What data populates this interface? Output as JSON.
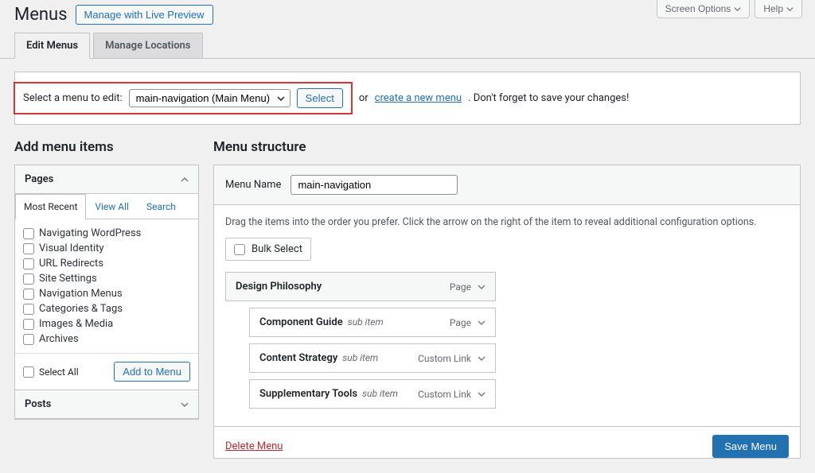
{
  "top": {
    "screen_options": "Screen Options",
    "help": "Help"
  },
  "header": {
    "title": "Menus",
    "live_preview": "Manage with Live Preview"
  },
  "tabs": {
    "edit": "Edit Menus",
    "locations": "Manage Locations"
  },
  "selectbar": {
    "label": "Select a menu to edit:",
    "selected": "main-navigation (Main Menu)",
    "select_btn": "Select",
    "or": "or",
    "create_link": "create a new menu",
    "tail": ". Don't forget to save your changes!"
  },
  "left": {
    "heading": "Add menu items",
    "pages_title": "Pages",
    "subtabs": {
      "recent": "Most Recent",
      "view_all": "View All",
      "search": "Search"
    },
    "pages": [
      "Navigating WordPress",
      "Visual Identity",
      "URL Redirects",
      "Site Settings",
      "Navigation Menus",
      "Categories & Tags",
      "Images & Media",
      "Archives"
    ],
    "select_all": "Select All",
    "add_btn": "Add to Menu",
    "posts_title": "Posts"
  },
  "right": {
    "heading": "Menu structure",
    "name_label": "Menu Name",
    "name_value": "main-navigation",
    "hint": "Drag the items into the order you prefer. Click the arrow on the right of the item to reveal additional configuration options.",
    "bulk": "Bulk Select",
    "items": [
      {
        "title": "Design Philosophy",
        "sub": false,
        "type": "Page"
      },
      {
        "title": "Component Guide",
        "sub": true,
        "type": "Page"
      },
      {
        "title": "Content Strategy",
        "sub": true,
        "type": "Custom Link"
      },
      {
        "title": "Supplementary Tools",
        "sub": true,
        "type": "Custom Link"
      }
    ],
    "sub_label": "sub item",
    "delete": "Delete Menu",
    "save": "Save Menu"
  }
}
